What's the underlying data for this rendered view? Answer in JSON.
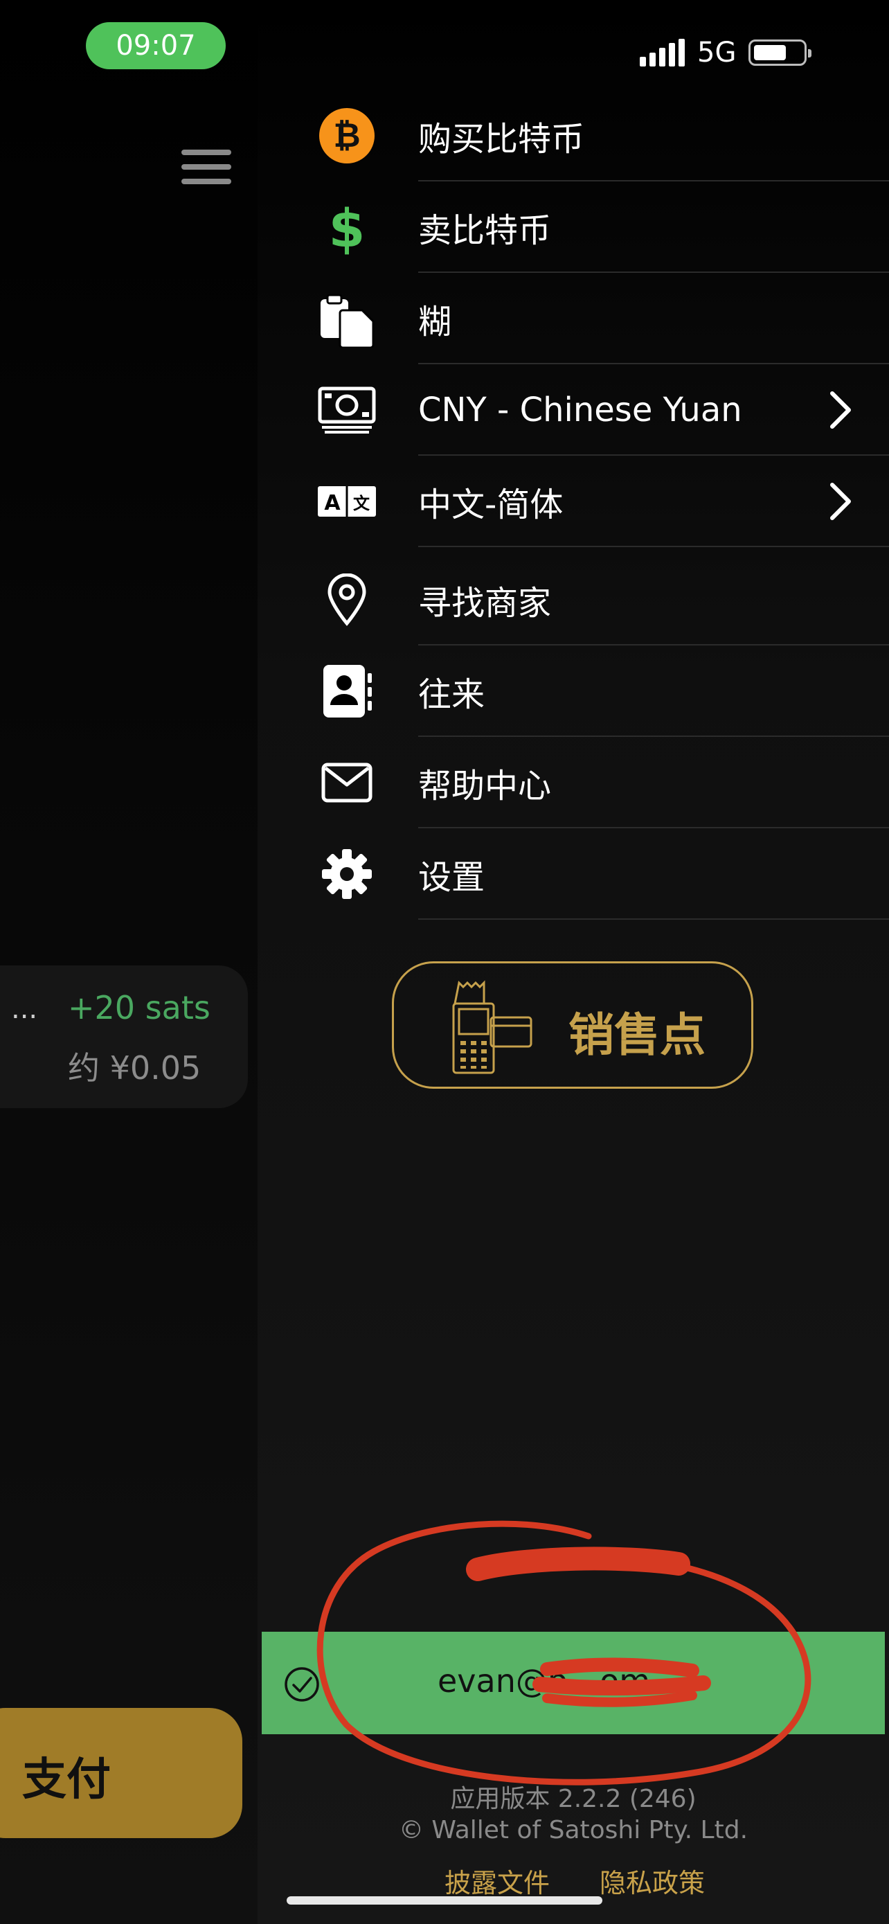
{
  "status_bar": {
    "time": "09:07",
    "network": "5G"
  },
  "menu": {
    "items": [
      {
        "label": "购买比特币",
        "icon": "bitcoin-icon"
      },
      {
        "label": "卖比特币",
        "icon": "dollar-icon"
      },
      {
        "label": "糊",
        "icon": "clipboard-icon"
      },
      {
        "label": "CNY - Chinese Yuan",
        "icon": "banknote-icon",
        "chevron": true
      },
      {
        "label": "中文-简体",
        "icon": "translate-icon",
        "chevron": true
      },
      {
        "label": "寻找商家",
        "icon": "location-pin-icon"
      },
      {
        "label": "往来",
        "icon": "contacts-icon"
      },
      {
        "label": "帮助中心",
        "icon": "mail-icon"
      },
      {
        "label": "设置",
        "icon": "gear-icon"
      }
    ]
  },
  "pos_button": {
    "label": "销售点"
  },
  "transaction": {
    "dots": "...",
    "amount": "+20 sats",
    "fiat": "约 ¥0.05"
  },
  "pay_button": {
    "label": "支付"
  },
  "toast": {
    "email": "evan@b…om"
  },
  "footer": {
    "version": "应用版本 2.2.2 (246)",
    "copyright": "© Wallet of Satoshi Pty. Ltd.",
    "disclosure": "披露文件",
    "privacy": "隐私政策"
  },
  "colors": {
    "bitcoin": "#f7931a",
    "green": "#4fc25a",
    "gold": "#c6a14c",
    "pay_gold": "#a07c28",
    "annotation_red": "#d63a22"
  }
}
